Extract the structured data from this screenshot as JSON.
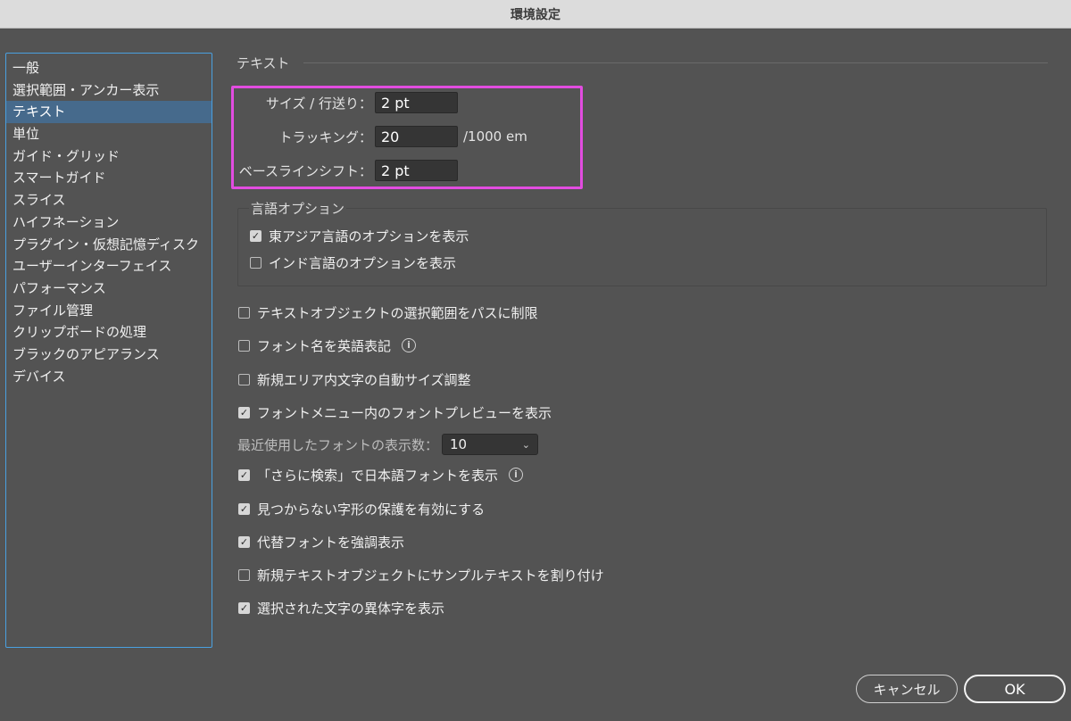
{
  "window": {
    "title": "環境設定"
  },
  "sidebar": {
    "items": [
      {
        "label": "一般"
      },
      {
        "label": "選択範囲・アンカー表示"
      },
      {
        "label": "テキスト",
        "selected": true
      },
      {
        "label": "単位"
      },
      {
        "label": "ガイド・グリッド"
      },
      {
        "label": "スマートガイド"
      },
      {
        "label": "スライス"
      },
      {
        "label": "ハイフネーション"
      },
      {
        "label": "プラグイン・仮想記憶ディスク"
      },
      {
        "label": "ユーザーインターフェイス"
      },
      {
        "label": "パフォーマンス"
      },
      {
        "label": "ファイル管理"
      },
      {
        "label": "クリップボードの処理"
      },
      {
        "label": "ブラックのアピアランス"
      },
      {
        "label": "デバイス"
      }
    ]
  },
  "main": {
    "section_title": "テキスト",
    "size_leading": {
      "label": "サイズ / 行送り：",
      "value": "2 pt"
    },
    "tracking": {
      "label": "トラッキング：",
      "value": "20",
      "unit": "/1000 em"
    },
    "baseline_shift": {
      "label": "ベースラインシフト：",
      "value": "2 pt"
    },
    "language_options": {
      "title": "言語オプション",
      "east_asian": {
        "label": "東アジア言語のオプションを表示",
        "checked": true
      },
      "indic": {
        "label": "インド言語のオプションを表示",
        "checked": false
      }
    },
    "options": [
      {
        "label": "テキストオブジェクトの選択範囲をパスに制限",
        "checked": false
      },
      {
        "label": "フォント名を英語表記",
        "checked": false,
        "info": true
      },
      {
        "label": "新規エリア内文字の自動サイズ調整",
        "checked": false
      },
      {
        "label": "フォントメニュー内のフォントプレビューを表示",
        "checked": true
      }
    ],
    "recent_fonts": {
      "label": "最近使用したフォントの表示数：",
      "value": "10"
    },
    "options2": [
      {
        "label": "「さらに検索」で日本語フォントを表示",
        "checked": true,
        "info": true
      },
      {
        "label": "見つからない字形の保護を有効にする",
        "checked": true
      },
      {
        "label": "代替フォントを強調表示",
        "checked": true
      },
      {
        "label": "新規テキストオブジェクトにサンプルテキストを割り付け",
        "checked": false
      },
      {
        "label": "選択された文字の異体字を表示",
        "checked": true
      }
    ]
  },
  "footer": {
    "cancel_label": "キャンセル",
    "ok_label": "OK"
  },
  "colors": {
    "background": "#535353",
    "selection": "#466a8c",
    "highlight_box": "#e24ce0",
    "focus_border": "#4aa0e0"
  },
  "icons": {
    "checkmark": "checkmark-icon",
    "info": "info-icon",
    "dropdown": "chevron-down-icon"
  }
}
